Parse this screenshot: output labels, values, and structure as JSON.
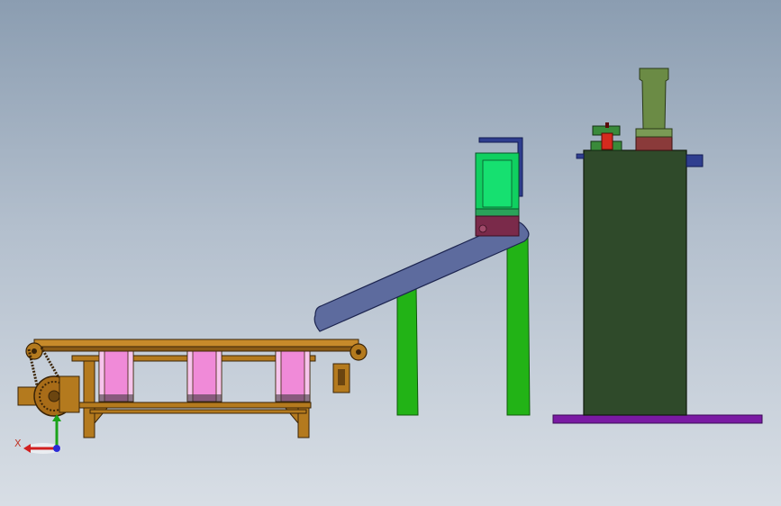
{
  "triad": {
    "x_label": "X",
    "x_color": "#d11f1f",
    "y_color": "#1aa31a",
    "z_color": "#2b2bd6"
  },
  "palette": {
    "conveyor_wood": "#b47a1e",
    "conveyor_dark": "#6b4510",
    "bin_pink": "#f08ad8",
    "chute_blue": "#5d6b9e",
    "support_green": "#22b316",
    "hopper_green": "#10d060",
    "hopper_maroon": "#7a2a4a",
    "bracket_navy": "#2f3e8f",
    "tower_green": "#2f4a2a",
    "base_purple": "#7a1aa3",
    "chimney_green": "#6b8b45",
    "chimney_base": "#8a3a3a",
    "valve_red": "#d52a1e",
    "valve_green": "#3a8a3a"
  },
  "components": {
    "bin_count": 3
  }
}
